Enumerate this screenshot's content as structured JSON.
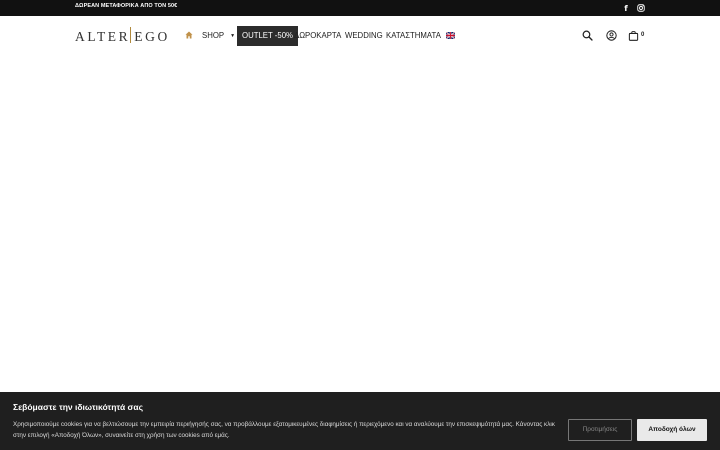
{
  "topbar": {
    "promo_text": "ΔΩΡΕΑΝ ΜΕΤΑΦΟΡΙΚΑ ΑΠΟ ΤΟΝ 50€",
    "social_icons": [
      "facebook-icon",
      "instagram-icon"
    ]
  },
  "header": {
    "logo": {
      "left": "ALTER",
      "right": "EGO"
    },
    "nav": {
      "home_icon": "home-icon",
      "shop": "SHOP",
      "shop_caret": "▼",
      "outlet": "OUTLET -50%",
      "giftcard": "ΔΩΡΟΚΑΡΤΑ",
      "wedding": "WEDDING",
      "stores": "ΚΑΤΑΣΤΗΜΑΤΑ",
      "language_flag": "uk-flag-icon"
    },
    "icons": [
      "search-icon",
      "account-icon",
      "cart-icon"
    ],
    "cart_count": "0"
  },
  "cookie_banner": {
    "title": "Σεβόμαστε την ιδιωτικότητά σας",
    "text": "Χρησιμοποιούμε cookies για να βελτιώσουμε την εμπειρία περιήγησής σας, να προβάλλουμε εξατομικευμένες διαφημίσεις ή περιεχόμενο και να αναλύουμε την επισκεψιμότητά μας. Κάνοντας κλικ στην επιλογή «Αποδοχή Όλων», συναινείτε στη χρήση των cookies από εμάς.",
    "preferences_button": "Προτιμήσεις",
    "accept_button": "Αποδοχή όλων"
  },
  "colors": {
    "topbar_bg": "#111111",
    "outlet_bg": "#2c2c2c",
    "logo_accent": "#b08a3e",
    "home_icon": "#c0914a",
    "cookie_bg": "#1f1f1f"
  }
}
